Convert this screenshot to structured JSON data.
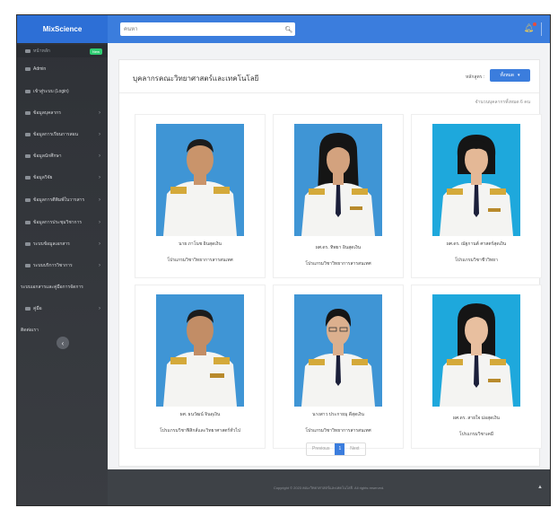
{
  "header": {
    "brand": "MixScience",
    "search_placeholder": "ค้นหา",
    "search_value": "ค้นหา"
  },
  "sidebar": {
    "items": [
      {
        "label": "หน้าหลัก",
        "badge": "New"
      },
      {
        "label": "Admin"
      },
      {
        "label": "เข้าสู่ระบบ (Login)"
      },
      {
        "label": "ข้อมูลบุคลากร"
      },
      {
        "label": "ข้อมูลการเรียนการสอน"
      },
      {
        "label": "ข้อมูลนักศึกษา"
      },
      {
        "label": "ข้อมูลวิจัย"
      },
      {
        "label": "ข้อมูลการตีพิมพ์ในวารสาร"
      },
      {
        "label": "ข้อมูลการประชุมวิชาการ"
      },
      {
        "label": "ระบบข้อมูลเอกสาร"
      },
      {
        "label": "ระบบบริการวิชาการ"
      },
      {
        "label": "ระบบเอกสารและคู่มือการจัดการ"
      },
      {
        "label": "คู่มือ"
      },
      {
        "label": "ติดต่อเรา"
      }
    ]
  },
  "main": {
    "title": "บุคลากรคณะวิทยาศาสตร์และเทคโนโลยี",
    "category_label": "หลักสูตร :",
    "category_value": "ทั้งหมด",
    "total_text": "จำนวนบุคลากรทั้งหมด 6 คน",
    "people": [
      {
        "name": "นาย ภาโนช อินสุดเงิน",
        "dept": "โปรแกรมวิชาวิทยาการสารสนเทศ"
      },
      {
        "name": "ผศ.ดร. ทิพยา อินสุดเงิน",
        "dept": "โปรแกรมวิชาวิทยาการสารสนเทศ"
      },
      {
        "name": "ผศ.ดร. ณัฐกานต์ ศาสตร์สุดเงิน",
        "dept": "โปรแกรมวิชาชีววิทยา"
      },
      {
        "name": "ผศ. ธนวัฒน์ จินดุเงิน",
        "dept": "โปรแกรมวิชาฟิสิกส์และวิทยาศาสตร์ทั่วไป"
      },
      {
        "name": "นางสาว ประกายมุ ดีสุดเงิน",
        "dept": "โปรแกรมวิชาวิทยาการสารสนเทศ"
      },
      {
        "name": "ผศ.ดร. สายใจ ม่อสุดเงิน",
        "dept": "โปรแกรมวิชาเคมี"
      }
    ],
    "pagination": {
      "prev": "Previous",
      "current": "1",
      "next": "Next"
    }
  },
  "footer": {
    "text": "Copyright © 2023 คณะวิทยาศาสตร์และเทคโนโลยี. All rights reserved."
  }
}
